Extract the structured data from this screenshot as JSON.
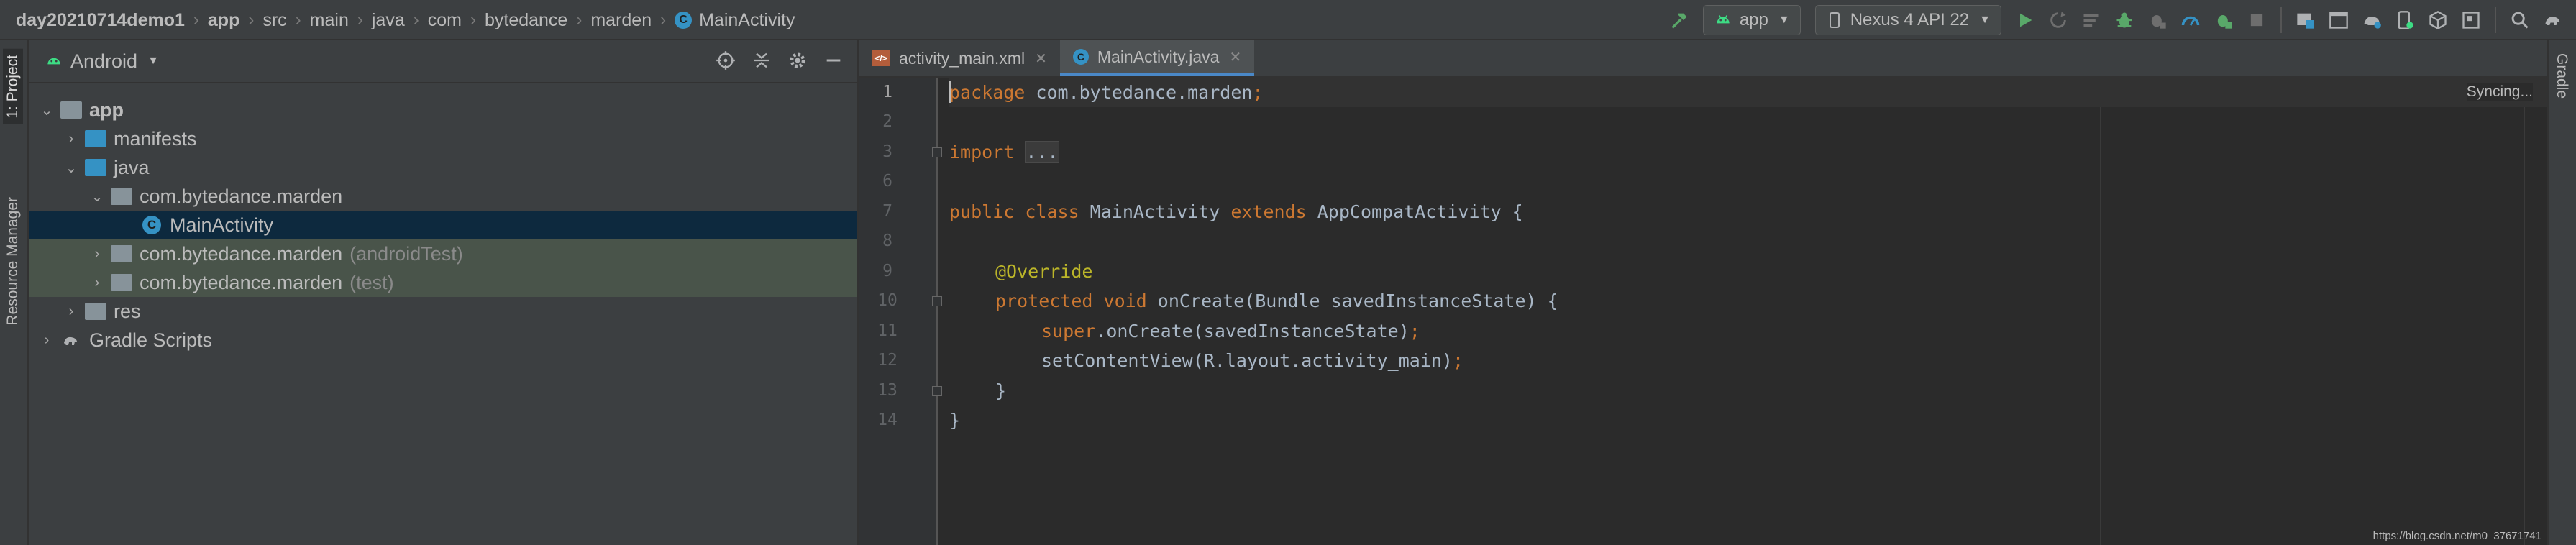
{
  "breadcrumb": [
    {
      "label": "day20210714demo1",
      "bold": true
    },
    {
      "label": "app",
      "bold": true
    },
    {
      "label": "src"
    },
    {
      "label": "main"
    },
    {
      "label": "java"
    },
    {
      "label": "com"
    },
    {
      "label": "bytedance"
    },
    {
      "label": "marden"
    },
    {
      "label": "MainActivity",
      "icon": "class-c-icon"
    }
  ],
  "toolbar": {
    "run_config": "app",
    "device": "Nexus 4 API 22",
    "icons": [
      "hammer-build-icon",
      "run-play-icon",
      "apply-changes-icon",
      "restart-activity-icon",
      "debug-bug-icon",
      "attach-debugger-icon",
      "profile-icon",
      "attach-process-icon",
      "stop-icon",
      "project-structure-icon",
      "avd-manager-icon",
      "sdk-manager-icon",
      "layout-inspector-icon",
      "device-file-icon",
      "search-icon"
    ]
  },
  "left_tabs": {
    "project": "1: Project",
    "resource_manager": "Resource Manager"
  },
  "right_tabs": {
    "gradle": "Gradle"
  },
  "project_panel": {
    "view_mode": "Android",
    "tree": [
      {
        "label": "app",
        "bold": true,
        "expanded": true
      },
      {
        "label": "manifests"
      },
      {
        "label": "java",
        "expanded": true
      },
      {
        "label": "com.bytedance.marden",
        "expanded": true
      },
      {
        "label": "MainActivity",
        "selected": true
      },
      {
        "label": "com.bytedance.marden",
        "suffix": "(androidTest)"
      },
      {
        "label": "com.bytedance.marden",
        "suffix": "(test)"
      },
      {
        "label": "res"
      },
      {
        "label": "Gradle Scripts"
      }
    ]
  },
  "editor": {
    "tabs": [
      {
        "label": "activity_main.xml",
        "active": false
      },
      {
        "label": "MainActivity.java",
        "active": true
      }
    ],
    "line_numbers": [
      "1",
      "2",
      "3",
      "6",
      "7",
      "8",
      "9",
      "10",
      "11",
      "12",
      "13",
      "14"
    ],
    "code": {
      "l1_kw": "package",
      "l1_rest": " com.bytedance.marden",
      "l1_semi": ";",
      "l3_kw": "import",
      "l3_fold": "...",
      "l7_kw1": "public class",
      "l7_name": " MainActivity ",
      "l7_kw2": "extends",
      "l7_rest": " AppCompatActivity {",
      "l9_ann": "@Override",
      "l10_kw": "protected void",
      "l10_rest": " onCreate(Bundle savedInstanceState) {",
      "l11_kw": "super",
      "l11_rest": ".onCreate(savedInstanceState)",
      "l11_semi": ";",
      "l12_text": "setContentView(R.layout.activity_main)",
      "l12_semi": ";",
      "l13_text": "}",
      "l14_text": "}"
    },
    "status": "Syncing..."
  },
  "watermark": "https://blog.csdn.net/m0_37671741"
}
